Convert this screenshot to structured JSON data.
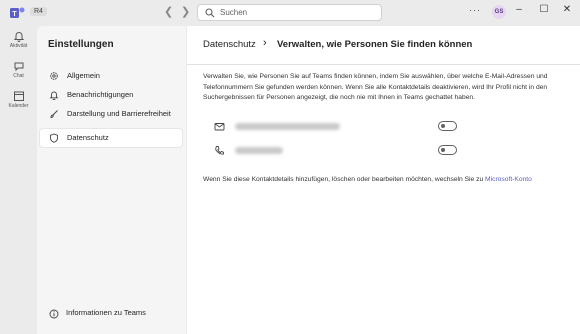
{
  "titlebar": {
    "badge": "R4",
    "search_placeholder": "Suchen",
    "more": "···",
    "avatar_initials": "GS",
    "minimize": "–",
    "maximize": "☐",
    "close": "✕"
  },
  "rail": {
    "items": [
      {
        "label": "Aktivität",
        "icon": "bell-icon"
      },
      {
        "label": "Chat",
        "icon": "chat-icon"
      },
      {
        "label": "Kalender",
        "icon": "calendar-icon"
      }
    ]
  },
  "settings": {
    "title": "Einstellungen",
    "menu": [
      {
        "label": "Allgemein",
        "icon": "gear-icon"
      },
      {
        "label": "Benachrichtigungen",
        "icon": "bell-icon"
      },
      {
        "label": "Darstellung und Barrierefreiheit",
        "icon": "brush-icon"
      },
      {
        "label": "Datenschutz",
        "icon": "shield-icon",
        "active": true
      }
    ],
    "info_label": "Informationen zu Teams"
  },
  "main": {
    "breadcrumb_parent": "Datenschutz",
    "breadcrumb_separator": "›",
    "breadcrumb_current": "Verwalten, wie Personen Sie finden können",
    "description": "Verwalten Sie, wie Personen Sie auf Teams finden können, indem Sie auswählen, über welche E-Mail-Adressen und Telefonnummern Sie gefunden werden können. Wenn Sie alle Kontaktdetails deaktivieren, wird Ihr Profil nicht in den Suchergebnissen für Personen angezeigt, die noch nie mit Ihnen in Teams gechattet haben.",
    "contacts": [
      {
        "type": "email",
        "icon": "mail-icon",
        "enabled": false
      },
      {
        "type": "phone",
        "icon": "phone-icon",
        "enabled": false
      }
    ],
    "footer_text": "Wenn Sie diese Kontaktdetails hinzufügen, löschen oder bearbeiten möchten, wechseln Sie zu ",
    "footer_link": "Microsoft-Konto"
  },
  "colors": {
    "accent": "#5b5fc7",
    "rail_bg": "#ebebeb",
    "pane_bg": "#f5f5f5"
  }
}
